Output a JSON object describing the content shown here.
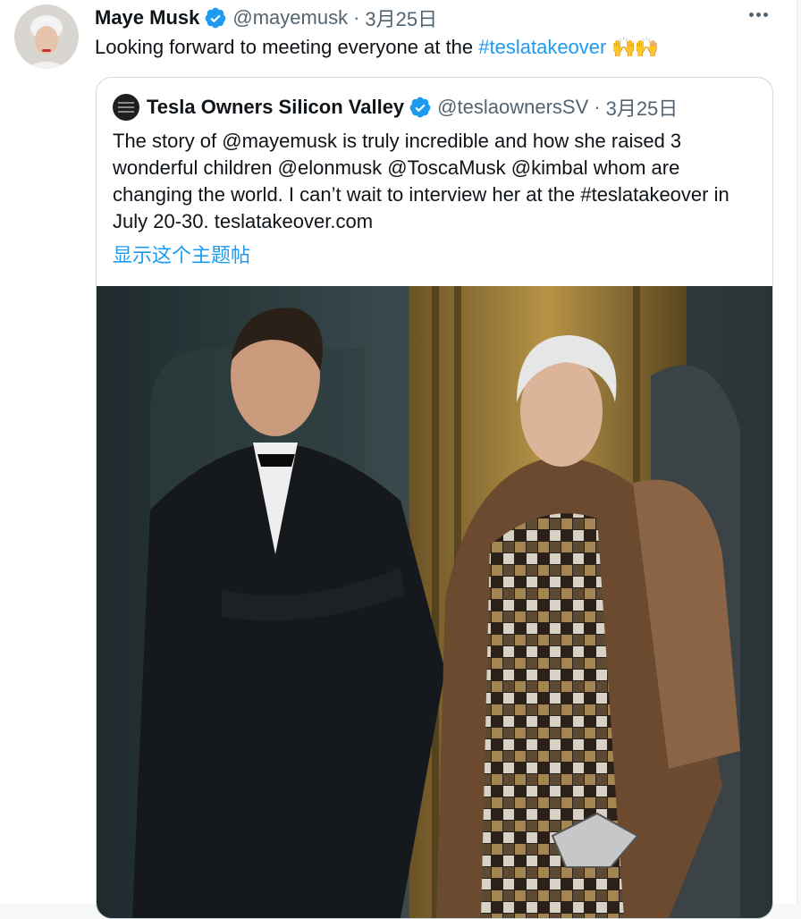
{
  "tweet": {
    "author_name": "Maye Musk",
    "handle": "@mayemusk",
    "separator": "·",
    "date": "3月25日",
    "text_before": "Looking forward to meeting everyone at the ",
    "hashtag": "#teslatakeover",
    "emoji": "🙌🙌",
    "icons": {
      "verified": "verified-badge-icon",
      "more": "more-options-icon"
    },
    "colors": {
      "link": "#1d9bf0",
      "muted": "#536471",
      "verified": "#1d9bf0"
    }
  },
  "quoted": {
    "author_name": "Tesla Owners Silicon Valley",
    "handle": "@teslaownersSV",
    "separator": "·",
    "date": "3月25日",
    "lines": [
      "The story of @mayemusk is truly incredible and how she raised 3",
      "wonderful children @elonmusk @ToscaMusk @kimbal whom are",
      "changing the world. I can’t wait to interview her at the #teslatakeover in",
      "July 20-30. teslatakeover.com"
    ],
    "show_thread": "显示这个主题帖"
  }
}
